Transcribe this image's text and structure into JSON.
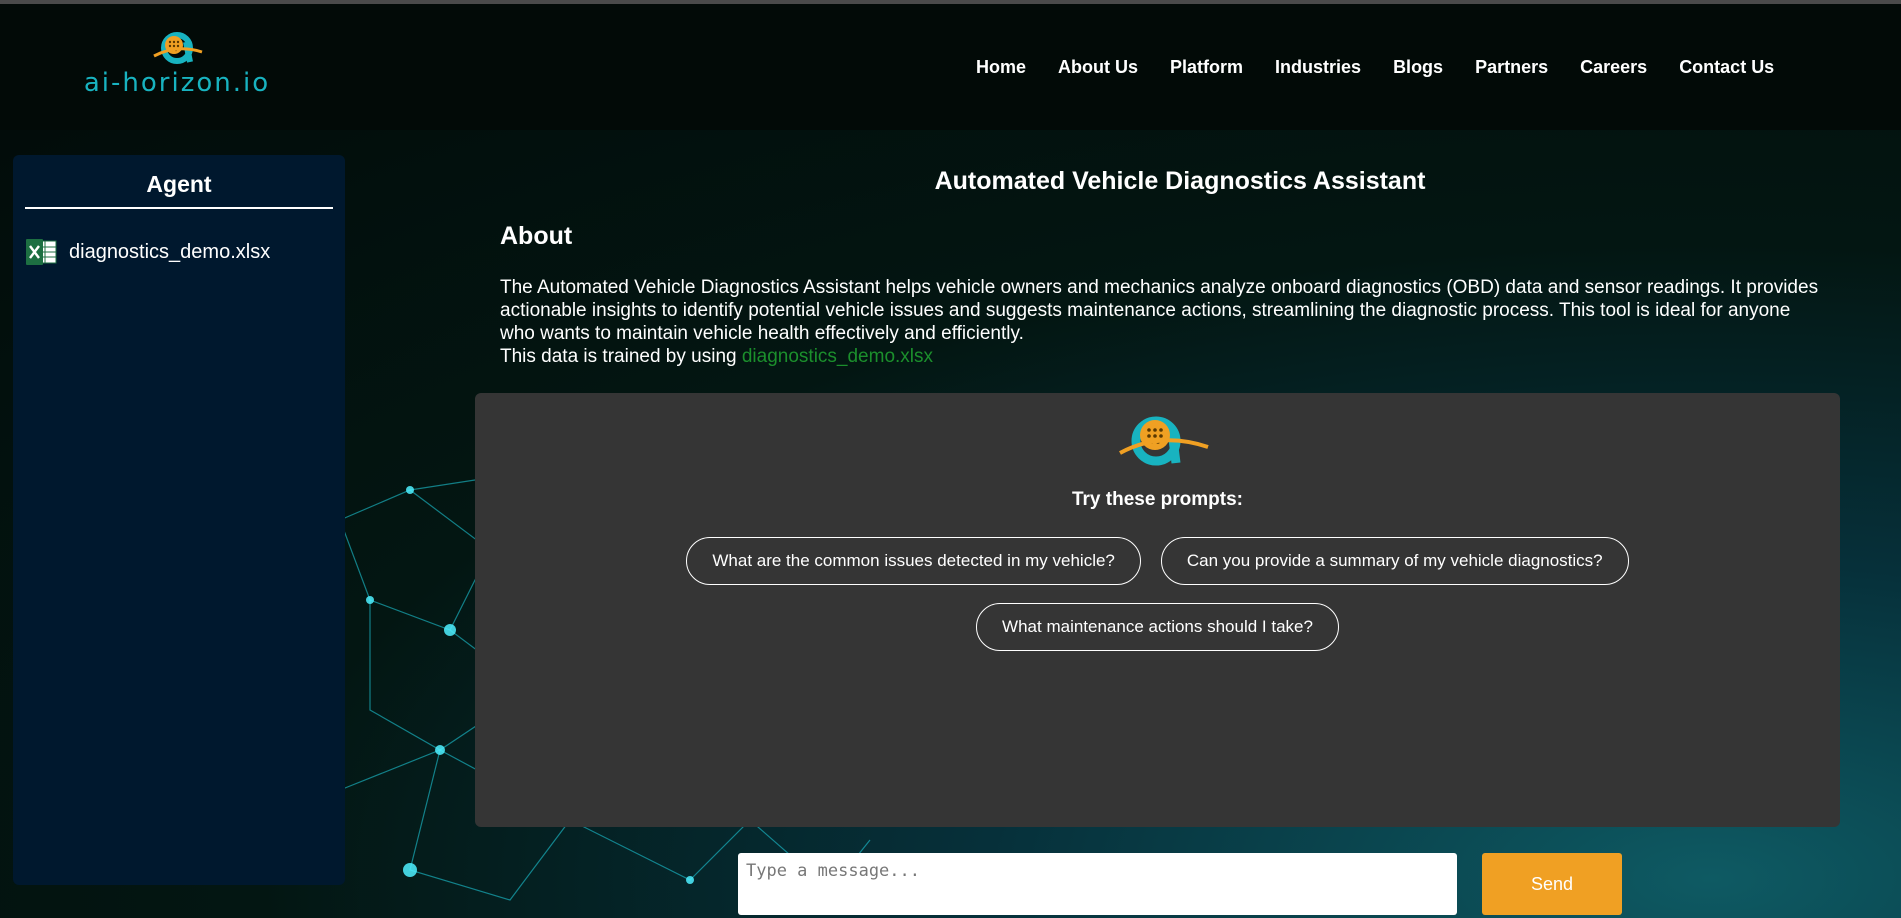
{
  "header": {
    "logo_text": "ai-horizon.io",
    "nav": [
      "Home",
      "About Us",
      "Platform",
      "Industries",
      "Blogs",
      "Partners",
      "Careers",
      "Contact Us"
    ]
  },
  "sidebar": {
    "title": "Agent",
    "files": [
      {
        "name": "diagnostics_demo.xlsx",
        "icon": "excel-file-icon"
      }
    ]
  },
  "main": {
    "title": "Automated Vehicle Diagnostics Assistant",
    "about_heading": "About",
    "about_text": "The Automated Vehicle Diagnostics Assistant helps vehicle owners and mechanics analyze onboard diagnostics (OBD) data and sensor readings. It provides actionable insights to identify potential vehicle issues and suggests maintenance actions, streamlining the diagnostic process. This tool is ideal for anyone who wants to maintain vehicle health effectively and efficiently.",
    "trained_prefix": "This data is trained by using ",
    "trained_file": "diagnostics_demo.xlsx"
  },
  "chat": {
    "prompts_heading": "Try these prompts:",
    "prompts": [
      "What are the common issues detected in my vehicle?",
      "Can you provide a summary of my vehicle diagnostics?",
      "What maintenance actions should I take?"
    ],
    "input_placeholder": "Type a message...",
    "send_label": "Send"
  },
  "colors": {
    "accent_orange": "#f0a023",
    "logo_teal": "#18b3c0",
    "link_green": "#1b8f2c",
    "panel_gray": "#353535",
    "sidebar_navy": "#00182e"
  }
}
